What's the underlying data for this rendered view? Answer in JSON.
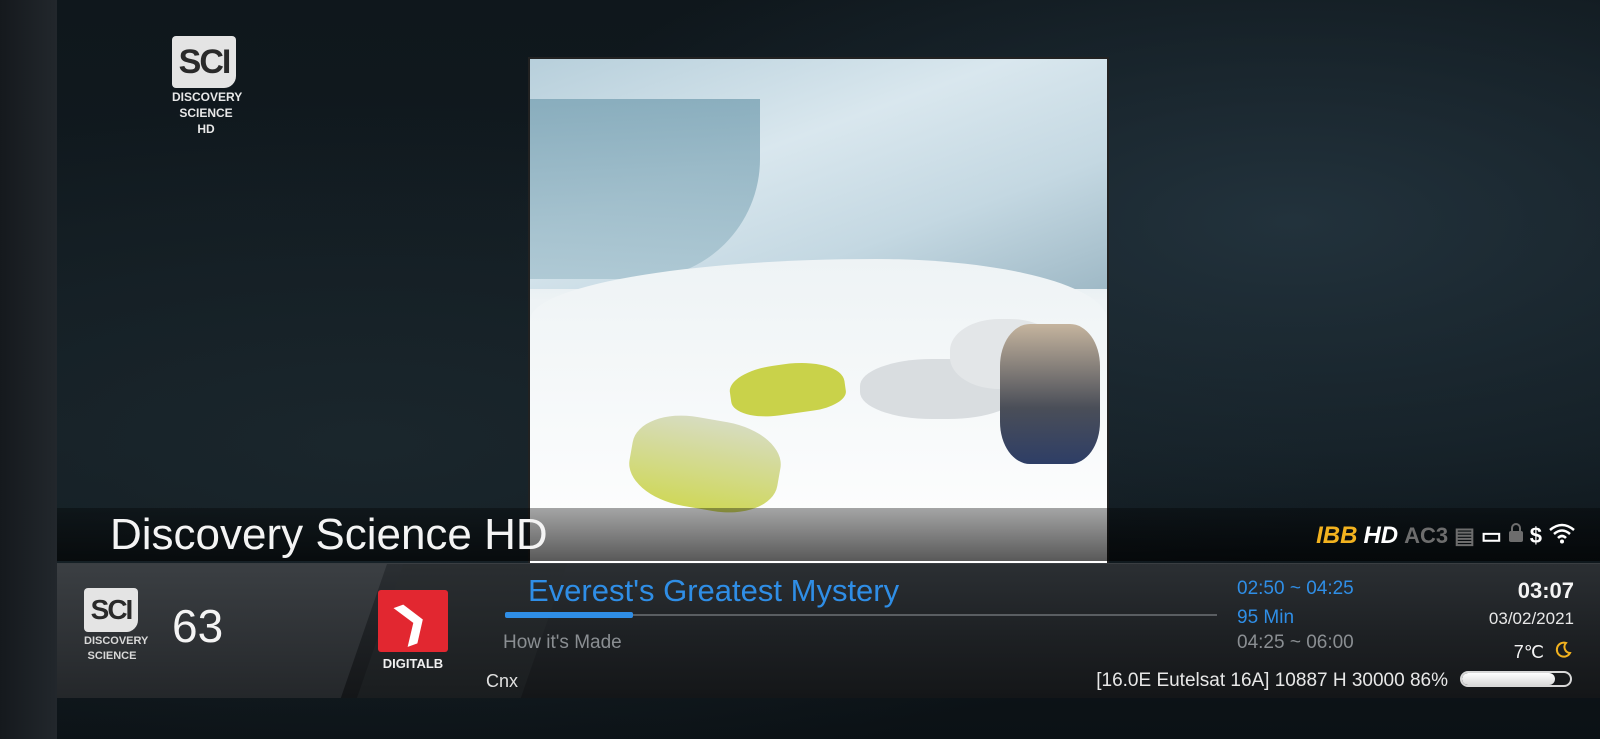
{
  "overlay_logo": {
    "abbr": "SCI",
    "line1": "DISCOVERY",
    "line2": "SCIENCE",
    "line3": "HD"
  },
  "channel_name": "Discovery Science HD",
  "indicators": {
    "ibb": "IBB",
    "hd": "HD",
    "audio": "AC3",
    "subtitle": "▤",
    "screen": "▭",
    "lock": "🔒",
    "dollar": "$",
    "wifi": "◉"
  },
  "infobar": {
    "small_logo": {
      "abbr": "SCI",
      "line1": "DISCOVERY",
      "line2": "SCIENCE"
    },
    "channel_number": "63",
    "provider": {
      "mark": "❯",
      "label": "DIGITALB",
      "color": "#e22730"
    },
    "current_program": {
      "title": "Everest's Greatest Mystery",
      "time": "02:50 ~ 04:25",
      "remaining": "95 Min",
      "progress": 0.18
    },
    "next_program": {
      "title": "How it's Made",
      "time": "04:25 ~ 06:00"
    },
    "clock": "03:07",
    "date": "03/02/2021",
    "temperature": "7℃",
    "weather_icon": "moon-icon",
    "cnx": "Cnx",
    "satellite": "[16.0E Eutelsat 16A] 10887 H 30000",
    "signal_percent": "86%",
    "signal_level": 0.86
  },
  "colors": {
    "accent_blue": "#2f8ee6",
    "ibb_gold": "#f2b21f",
    "provider_red": "#e22730"
  }
}
